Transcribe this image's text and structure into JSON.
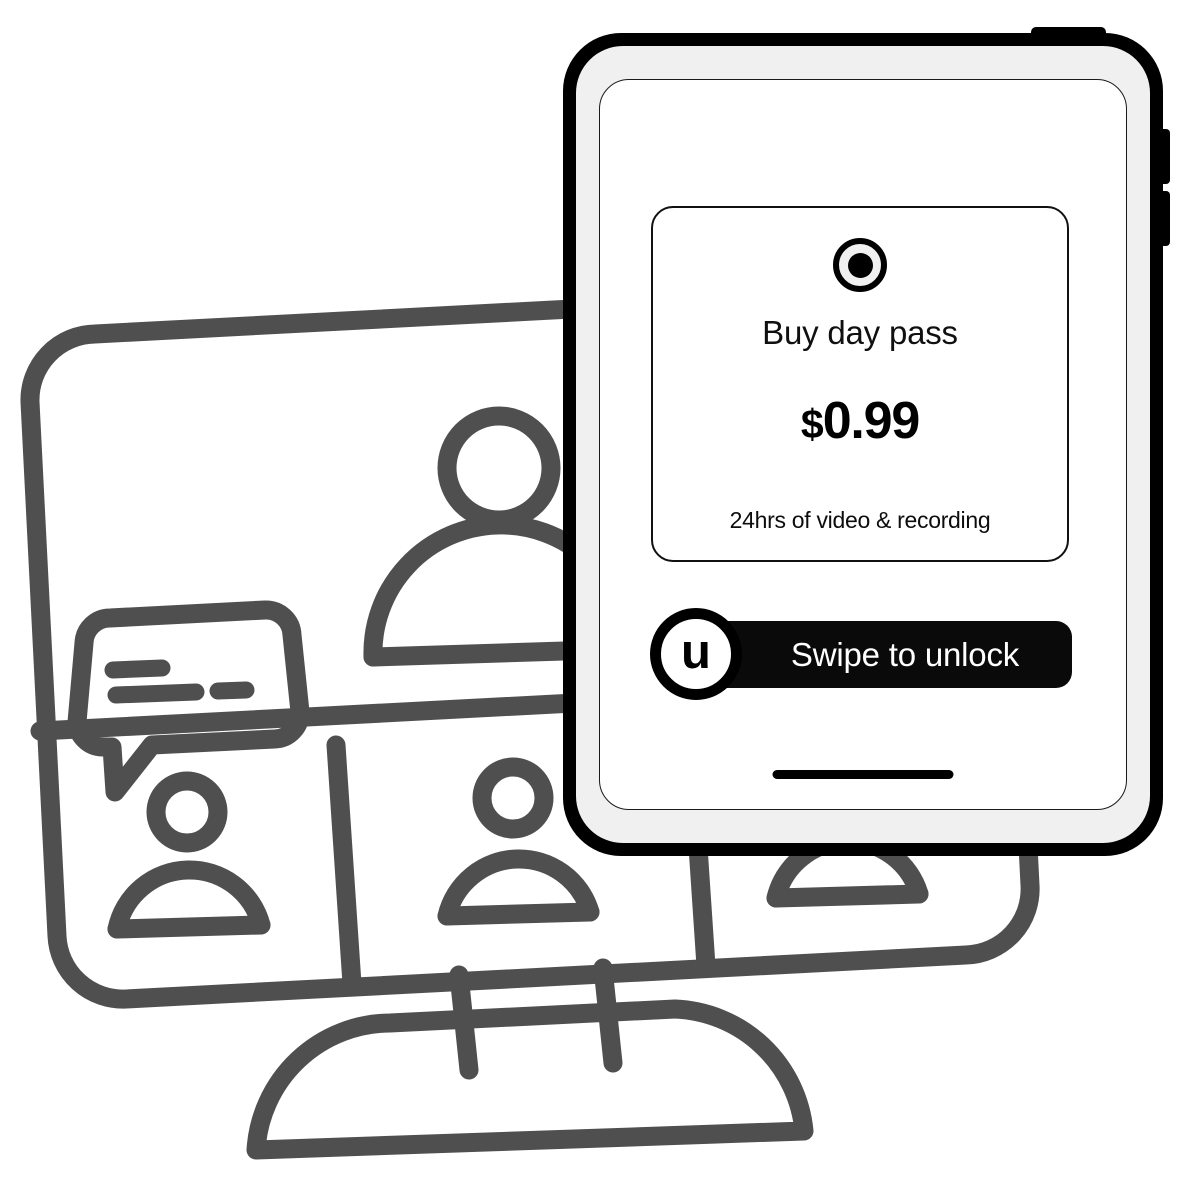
{
  "scene": {
    "background_color": "#ffffff",
    "illustration_stroke_color": "#4f4f4f"
  },
  "illustration": {
    "name": "video-conference-monitor",
    "description": "Outline drawing of a desktop monitor showing a video call grid with participant avatars and a chat bubble",
    "participants_count": 4,
    "chat_bubble_lines": 2
  },
  "device": {
    "name": "tablet",
    "shell_color": "#000000",
    "bezel_color": "#f0f0f0",
    "screen_color": "#ffffff",
    "buttons": [
      {
        "name": "power-button",
        "label": "Power"
      },
      {
        "name": "volume-up-button",
        "label": "Volume Up"
      },
      {
        "name": "volume-down-button",
        "label": "Volume Down"
      }
    ],
    "home_indicator": true
  },
  "screen": {
    "pass_card": {
      "radio": {
        "icon": "radio-button-selected-icon",
        "selected": true,
        "ring_color": "#000000",
        "dot_color": "#000000",
        "inner_color": "#f0f0f0"
      },
      "title": "Buy day pass",
      "price": {
        "currency": "$",
        "amount": "0.99",
        "full": "$0.99"
      },
      "subtitle": "24hrs of video & recording",
      "border_color": "#111111"
    },
    "swipe_unlock": {
      "knob_glyph": "u",
      "knob_icon": "unlock-brand-logo-icon",
      "label": "Swipe to unlock",
      "track_color": "#0a0a0a",
      "label_color": "#ffffff"
    }
  }
}
